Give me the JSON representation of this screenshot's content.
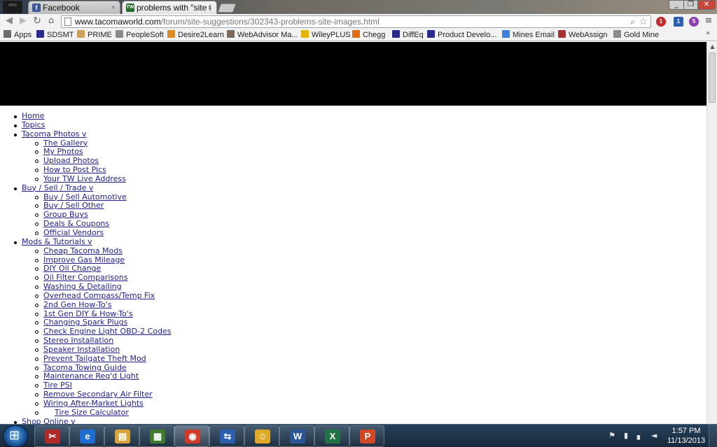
{
  "browser": {
    "tabs": [
      {
        "label": "Facebook",
        "favicon": "f"
      },
      {
        "label": "problems with \"site i",
        "favicon": "TW"
      }
    ],
    "url_host": "www.tacomaworld.com",
    "url_path": "/forum/site-suggestions/302343-problems-site-images.html",
    "bookmarks": [
      {
        "label": "Apps",
        "icon_color": "#6b6b6b"
      },
      {
        "label": "SDSMT",
        "icon_color": "#2a2a8a"
      },
      {
        "label": "PRIME",
        "icon_color": "#c8a25a"
      },
      {
        "label": "PeopleSoft",
        "icon_color": "#8a8a8a"
      },
      {
        "label": "Desire2Learn",
        "icon_color": "#e08a1e"
      },
      {
        "label": "WebAdvisor Ma...",
        "icon_color": "#7a6a5a"
      },
      {
        "label": "WileyPLUS",
        "icon_color": "#e3b400"
      },
      {
        "label": "Chegg",
        "icon_color": "#e06b10"
      },
      {
        "label": "DiffEq",
        "icon_color": "#2a2a8a"
      },
      {
        "label": "Product Develo...",
        "icon_color": "#2a2a8a"
      },
      {
        "label": "Mines Email",
        "icon_color": "#3f7fe0"
      },
      {
        "label": "WebAssign",
        "icon_color": "#a83232"
      },
      {
        "label": "Gold Mine",
        "icon_color": "#8a8a8a"
      }
    ],
    "extension_badges": [
      "1",
      "1",
      "5"
    ]
  },
  "nav": [
    {
      "label": "Home"
    },
    {
      "label": "Topics"
    },
    {
      "label": "Tacoma Photos v",
      "children": [
        "The Gallery",
        "My Photos",
        "Upload Photos",
        "How to Post Pics",
        "Your TW Live Address"
      ]
    },
    {
      "label": "Buy / Sell / Trade v",
      "children": [
        "Buy / Sell Automotive",
        "Buy / Sell Other",
        "Group Buys",
        "Deals & Coupons",
        "Official Vendors"
      ]
    },
    {
      "label": "Mods & Tutorials v",
      "children": [
        "Cheap Tacoma Mods",
        "Improve Gas Mileage",
        "DIY Oil Change",
        "Oil Filter Comparisons",
        "Washing & Detailing",
        "Overhead Compass/Temp Fix",
        "2nd Gen How-To's",
        "1st Gen DIY & How-To's",
        "Changing Spark Plugs",
        "Check Engine Light OBD-2 Codes",
        "Stereo Installation",
        "Speaker Installation",
        "Prevent Tailgate Theft Mod",
        "Tacoma Towing Guide",
        "Maintenance Req'd Light",
        "Tire PSI",
        "Remove Secondary Air Filter",
        "Wiring After-Market Lights",
        "Tire Size Calculator"
      ]
    },
    {
      "label": "Shop Online v"
    }
  ],
  "taskbar": {
    "apps": [
      {
        "name": "snipping-tool",
        "glyph": "✂",
        "color": "#b02a2a"
      },
      {
        "name": "internet-explorer",
        "glyph": "e",
        "color": "#1e6fd1"
      },
      {
        "name": "file-explorer",
        "glyph": "▤",
        "color": "#d9a53a"
      },
      {
        "name": "minecraft",
        "glyph": "▦",
        "color": "#3f7b2b"
      },
      {
        "name": "chrome",
        "glyph": "◉",
        "color": "#d23b2a"
      },
      {
        "name": "remote-desktop",
        "glyph": "⇆",
        "color": "#2a5fb0"
      },
      {
        "name": "outlook-contacts",
        "glyph": "☺",
        "color": "#e0a92a"
      },
      {
        "name": "word",
        "glyph": "W",
        "color": "#2b579a"
      },
      {
        "name": "excel",
        "glyph": "X",
        "color": "#217346"
      },
      {
        "name": "powerpoint",
        "glyph": "P",
        "color": "#d24726"
      }
    ],
    "time": "1:57 PM",
    "date": "11/13/2013"
  }
}
